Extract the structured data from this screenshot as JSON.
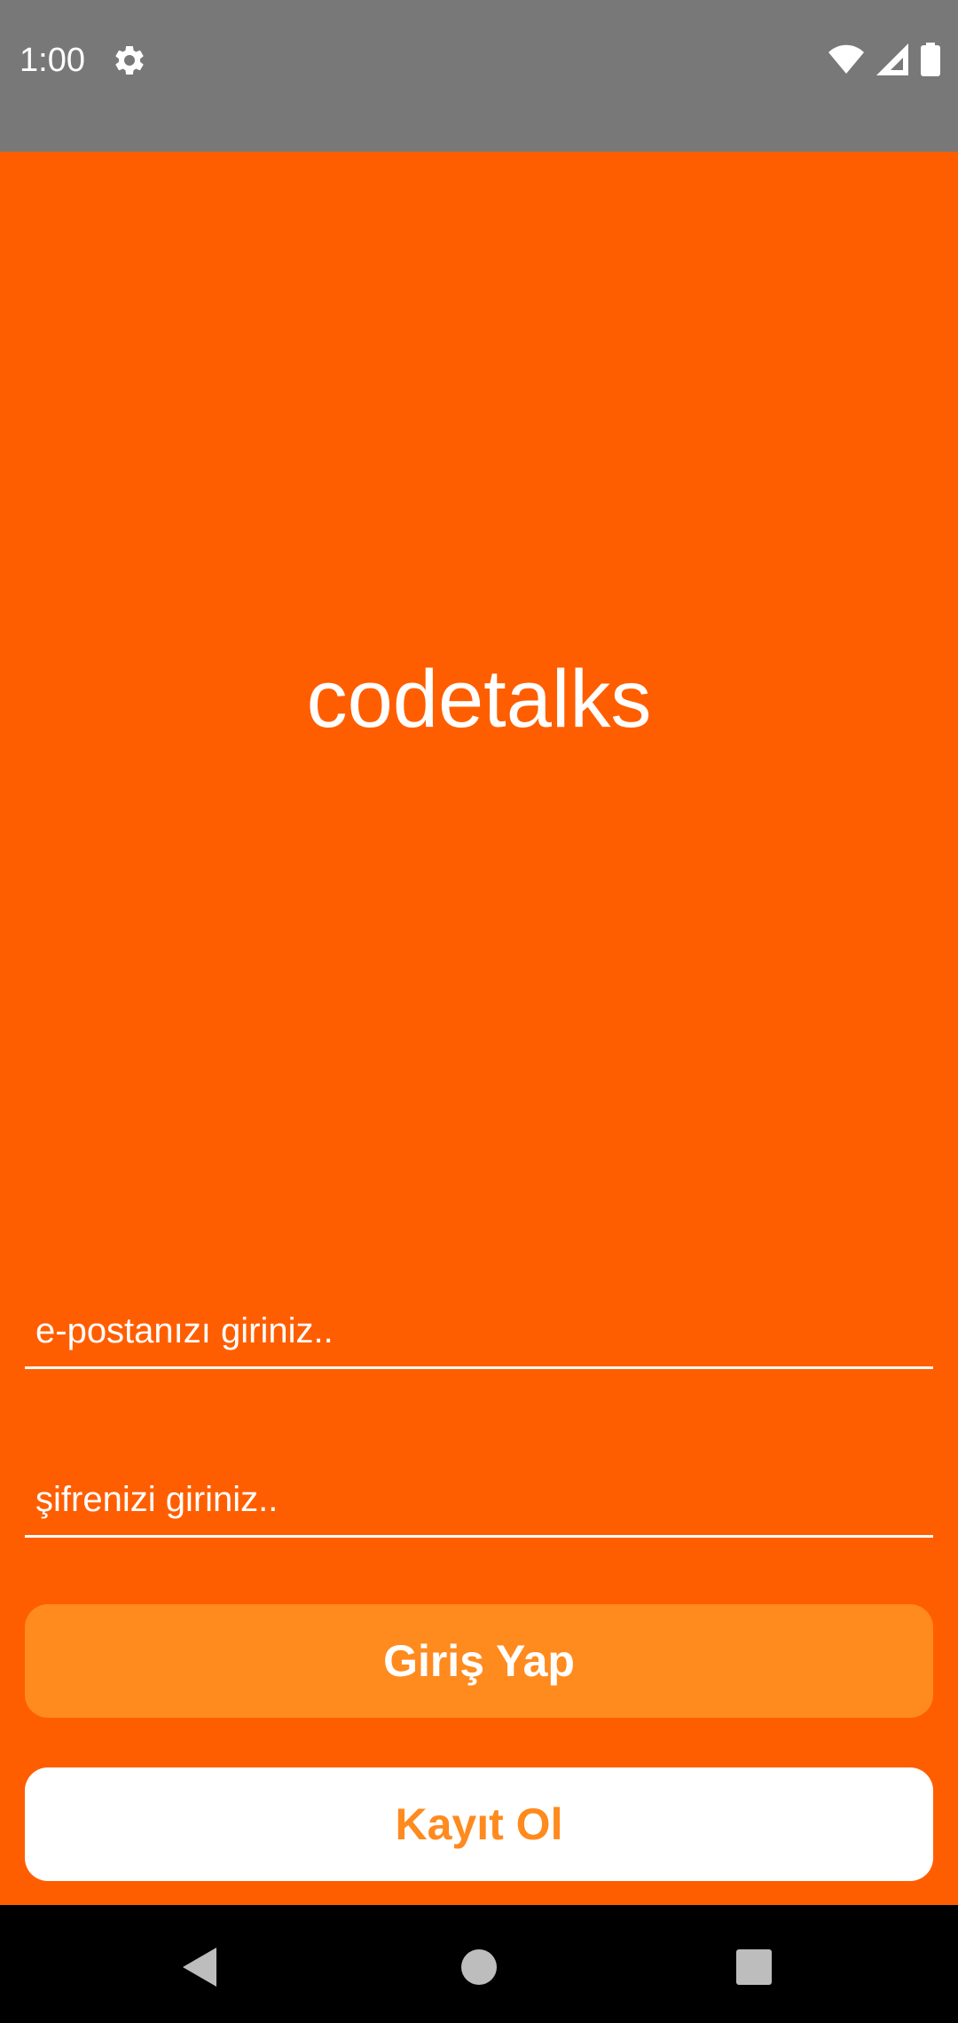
{
  "status_bar": {
    "time": "1:00",
    "icons": [
      "gear-icon",
      "wifi-icon",
      "signal-icon",
      "battery-icon"
    ],
    "background": "#787878"
  },
  "app": {
    "brand": "codetalks",
    "background": "#FF5E00",
    "email_input": {
      "placeholder": "e-postanızı giriniz..",
      "value": ""
    },
    "password_input": {
      "placeholder": "şifrenizi giriniz..",
      "value": ""
    },
    "login_button": {
      "label": "Giriş Yap",
      "background": "#FF8A1E",
      "text_color": "#FFFFFF"
    },
    "register_button": {
      "label": "Kayıt Ol",
      "background": "#FFFFFF",
      "text_color": "#FF8A1E"
    }
  },
  "nav_bar": {
    "icons": [
      "back-icon",
      "home-icon",
      "recents-icon"
    ]
  }
}
